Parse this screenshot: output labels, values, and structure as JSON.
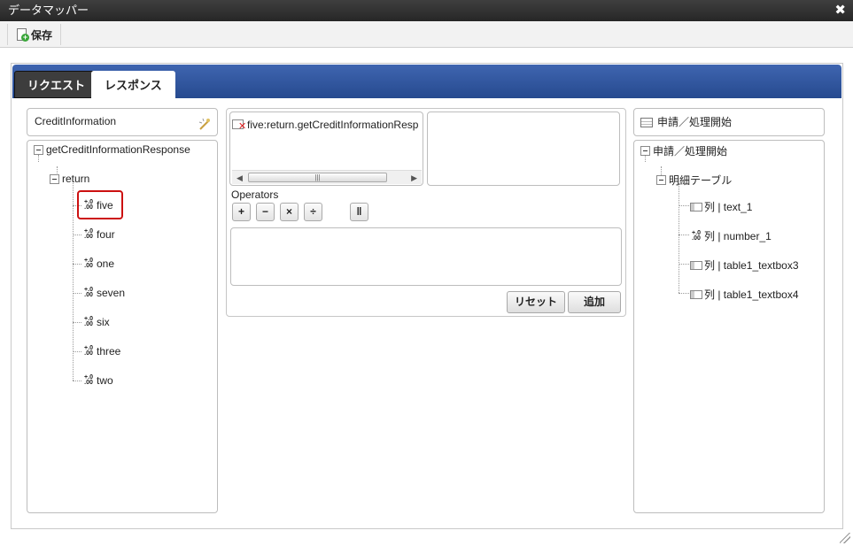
{
  "window": {
    "title": "データマッパー",
    "close_glyph": "✖"
  },
  "toolbar": {
    "save_label": "保存",
    "save_icon": "new-document-icon"
  },
  "tabs": [
    {
      "label": "リクエスト"
    },
    {
      "label": "レスポンス",
      "active": true
    }
  ],
  "left_panel": {
    "header_label": "CreditInformation",
    "header_icon": "settings-wand-icon",
    "root": "getCreditInformationResponse",
    "child": "return",
    "fields": [
      "five",
      "four",
      "one",
      "seven",
      "six",
      "three",
      "two"
    ],
    "highlighted": "five"
  },
  "middle_panel": {
    "selected_path": "five:return.getCreditInformationResp",
    "operators_label": "Operators",
    "operators": [
      "+",
      "−",
      "×",
      "÷",
      "‖"
    ],
    "reset_label": "リセット",
    "add_label": "追加"
  },
  "right_panel": {
    "header_label": "申請／処理開始",
    "root": "申請／処理開始",
    "table": "明細テーブル",
    "columns": [
      "列 | text_1",
      "列 | number_1",
      "列 | table1_textbox3",
      "列 | table1_textbox4"
    ]
  },
  "colors": {
    "tab_strip": "#2f56a0",
    "highlight": "#cc1111",
    "title_bar": "#333333"
  }
}
